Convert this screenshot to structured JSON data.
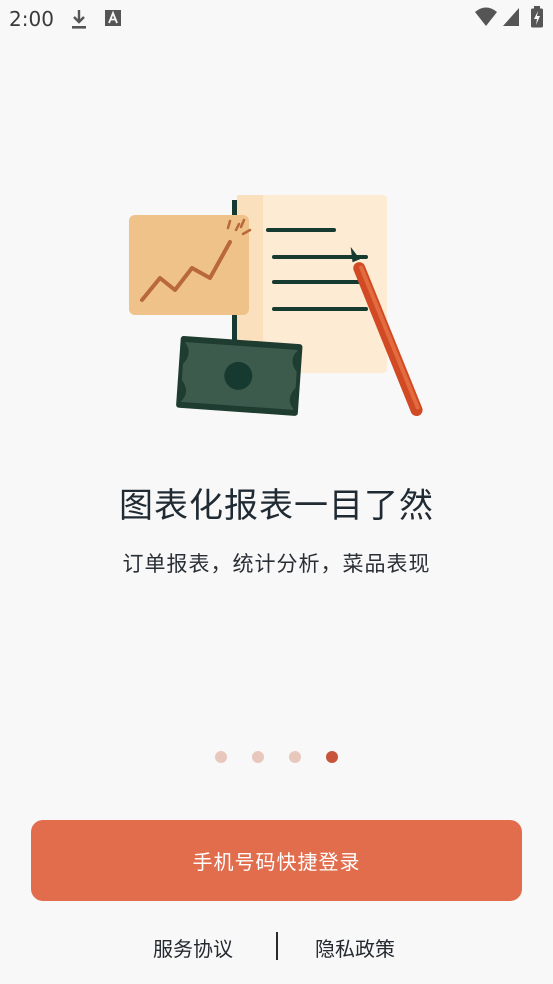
{
  "status_bar": {
    "time": "2:00",
    "icons": [
      "download-icon",
      "text-a-icon",
      "wifi-icon",
      "signal-icon",
      "battery-charging-icon"
    ]
  },
  "onboarding": {
    "title": "图表化报表一目了然",
    "subtitle": "订单报表，统计分析，菜品表现",
    "pages_total": 4,
    "page_active": 4
  },
  "actions": {
    "login_label": "手机号码快捷登录",
    "terms_label": "服务协议",
    "privacy_label": "隐私政策"
  },
  "colors": {
    "accent": "#e16d4d",
    "dot_active": "#c8553b",
    "dot_inactive": "#e8c8bd",
    "background": "#f8f8f8"
  }
}
